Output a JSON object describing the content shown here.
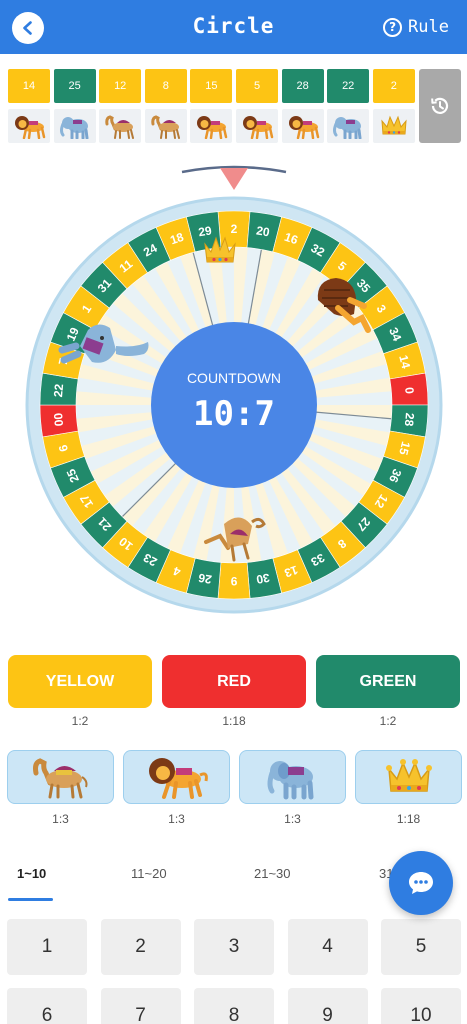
{
  "header": {
    "title": "Circle",
    "rule_label": "Rule",
    "back_icon": "arrow-left-icon",
    "rule_icon": "question-icon",
    "bg_color": "#2f7de1"
  },
  "history": [
    {
      "number": "14",
      "color": "yellow",
      "animal": "lion"
    },
    {
      "number": "25",
      "color": "green",
      "animal": "elephant"
    },
    {
      "number": "12",
      "color": "yellow",
      "animal": "camel"
    },
    {
      "number": "8",
      "color": "yellow",
      "animal": "camel"
    },
    {
      "number": "15",
      "color": "yellow",
      "animal": "lion"
    },
    {
      "number": "5",
      "color": "yellow",
      "animal": "lion"
    },
    {
      "number": "28",
      "color": "green",
      "animal": "lion"
    },
    {
      "number": "22",
      "color": "green",
      "animal": "elephant"
    },
    {
      "number": "2",
      "color": "yellow",
      "animal": "crown"
    }
  ],
  "wheel": {
    "numbers": [
      "2",
      "20",
      "16",
      "32",
      "5",
      "35",
      "3",
      "34",
      "14",
      "0",
      "28",
      "15",
      "36",
      "12",
      "27",
      "8",
      "33",
      "13",
      "30",
      "9",
      "26",
      "4",
      "23",
      "10",
      "21",
      "17",
      "25",
      "6",
      "00",
      "22",
      "7",
      "19",
      "1",
      "31",
      "11",
      "24",
      "18",
      "29"
    ],
    "colors": [
      "yellow",
      "green",
      "yellow",
      "green",
      "yellow",
      "green",
      "yellow",
      "green",
      "yellow",
      "red",
      "green",
      "yellow",
      "green",
      "yellow",
      "green",
      "yellow",
      "green",
      "yellow",
      "green",
      "yellow",
      "green",
      "yellow",
      "green",
      "yellow",
      "green",
      "yellow",
      "green",
      "yellow",
      "red",
      "green",
      "yellow",
      "green",
      "yellow",
      "green",
      "yellow",
      "green",
      "yellow",
      "green"
    ],
    "countdown_label": "COUNTDOWN",
    "countdown_value": "10:7"
  },
  "bets": {
    "yellow": {
      "label": "YELLOW",
      "odds": "1:2"
    },
    "red": {
      "label": "RED",
      "odds": "1:18"
    },
    "green": {
      "label": "GREEN",
      "odds": "1:2"
    }
  },
  "animals": [
    {
      "name": "camel",
      "odds": "1:3"
    },
    {
      "name": "lion",
      "odds": "1:3"
    },
    {
      "name": "elephant",
      "odds": "1:3"
    },
    {
      "name": "crown",
      "odds": "1:18"
    }
  ],
  "tabs": [
    "1~10",
    "11~20",
    "21~30",
    "31"
  ],
  "numbers": [
    "1",
    "2",
    "3",
    "4",
    "5",
    "6",
    "7",
    "8",
    "9",
    "10"
  ],
  "colors": {
    "yellow": "#fdc414",
    "green": "#218a6b",
    "red": "#ef2f2f",
    "blue": "#2f7de1",
    "wheel_bg": "#e8f2f7"
  },
  "icons": {
    "history": "history-icon",
    "chat": "chat-bubble-icon"
  }
}
